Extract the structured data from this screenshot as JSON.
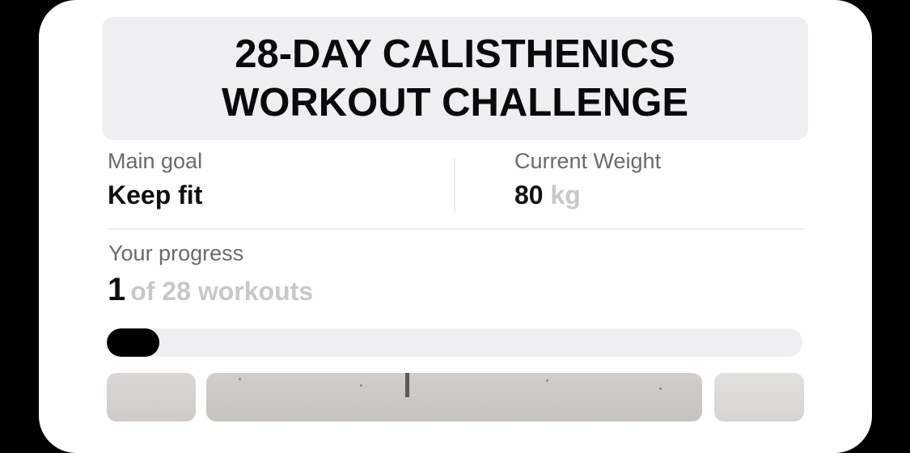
{
  "title": {
    "line1": "28-DAY CALISTHENICS",
    "line2": "WORKOUT CHALLENGE"
  },
  "main_goal": {
    "label": "Main goal",
    "value": "Keep fit"
  },
  "current_weight": {
    "label": "Current Weight",
    "value": "80",
    "unit": "kg"
  },
  "progress": {
    "label": "Your progress",
    "completed": "1",
    "total_text": "of 28 workouts",
    "fraction": 0.076
  },
  "colors": {
    "background": "#000000",
    "card": "#ffffff",
    "title_box": "#efeff1",
    "bar_track": "#efeff1",
    "bar_fill": "#000000",
    "muted_text": "#c8c8c8"
  }
}
